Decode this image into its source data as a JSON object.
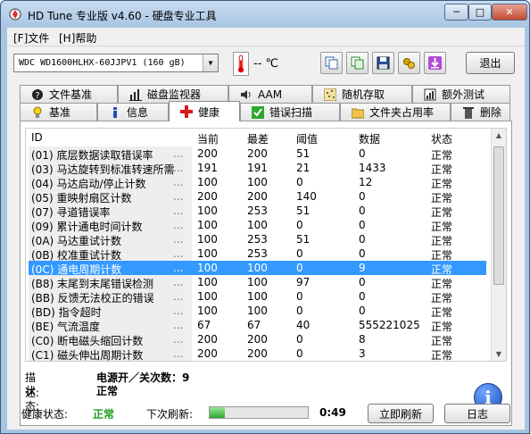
{
  "window": {
    "title": "HD Tune 专业版 v4.60 - 硬盘专业工具",
    "min_label": "─",
    "max_label": "□",
    "close_label": "✕"
  },
  "menu": [
    {
      "label": "[F]文件"
    },
    {
      "label": "[H]帮助"
    }
  ],
  "toolbar": {
    "drive": "WDC WD1600HLHX-60JJPV1 (160 gB)",
    "temperature": "-- ℃",
    "exit_label": "退出",
    "icons": [
      "copy-icon",
      "copy-all-icon",
      "save-icon",
      "options-icon",
      "download-icon"
    ]
  },
  "tabs_top": [
    {
      "label": "文件基准",
      "icon": "file-benchmark-icon"
    },
    {
      "label": "磁盘监视器",
      "icon": "disk-monitor-icon"
    },
    {
      "label": "AAM",
      "icon": "speaker-icon"
    },
    {
      "label": "随机存取",
      "icon": "random-access-icon"
    },
    {
      "label": "额外测试",
      "icon": "extra-tests-icon"
    }
  ],
  "tabs_bottom": [
    {
      "label": "基准",
      "icon": "bulb-icon"
    },
    {
      "label": "信息",
      "icon": "info-small-icon"
    },
    {
      "label": "健康",
      "icon": "health-cross-icon",
      "active": true
    },
    {
      "label": "错误扫描",
      "icon": "error-scan-icon"
    },
    {
      "label": "文件夹占用率",
      "icon": "folder-icon"
    },
    {
      "label": "删除",
      "icon": "trash-icon"
    }
  ],
  "table": {
    "headers": [
      "ID",
      "当前",
      "最差",
      "阈值",
      "数据",
      "状态"
    ],
    "rows": [
      {
        "id": "(01) 底层数据读取错误率",
        "current": "200",
        "worst": "200",
        "threshold": "51",
        "data": "0",
        "status": "正常"
      },
      {
        "id": "(03) 马达旋转到标准转速所需",
        "current": "191",
        "worst": "191",
        "threshold": "21",
        "data": "1433",
        "status": "正常"
      },
      {
        "id": "(04) 马达启动/停止计数",
        "current": "100",
        "worst": "100",
        "threshold": "0",
        "data": "12",
        "status": "正常"
      },
      {
        "id": "(05) 重映射扇区计数",
        "current": "200",
        "worst": "200",
        "threshold": "140",
        "data": "0",
        "status": "正常"
      },
      {
        "id": "(07) 寻道错误率",
        "current": "100",
        "worst": "253",
        "threshold": "51",
        "data": "0",
        "status": "正常"
      },
      {
        "id": "(09) 累计通电时间计数",
        "current": "100",
        "worst": "100",
        "threshold": "0",
        "data": "0",
        "status": "正常"
      },
      {
        "id": "(0A) 马达重试计数",
        "current": "100",
        "worst": "253",
        "threshold": "51",
        "data": "0",
        "status": "正常"
      },
      {
        "id": "(0B) 校准重试计数",
        "current": "100",
        "worst": "253",
        "threshold": "0",
        "data": "0",
        "status": "正常"
      },
      {
        "id": "(0C) 通电周期计数",
        "current": "100",
        "worst": "100",
        "threshold": "0",
        "data": "9",
        "status": "正常",
        "selected": true
      },
      {
        "id": "(B8) 末尾到末尾错误检测",
        "current": "100",
        "worst": "100",
        "threshold": "97",
        "data": "0",
        "status": "正常"
      },
      {
        "id": "(BB) 反馈无法校正的错误",
        "current": "100",
        "worst": "100",
        "threshold": "0",
        "data": "0",
        "status": "正常"
      },
      {
        "id": "(BD) 指令超时",
        "current": "100",
        "worst": "100",
        "threshold": "0",
        "data": "0",
        "status": "正常"
      },
      {
        "id": "(BE) 气流温度",
        "current": "67",
        "worst": "67",
        "threshold": "40",
        "data": "555221025",
        "status": "正常"
      },
      {
        "id": "(C0) 断电磁头缩回计数",
        "current": "200",
        "worst": "200",
        "threshold": "0",
        "data": "8",
        "status": "正常"
      },
      {
        "id": "(C1) 磁头伸出周期计数",
        "current": "200",
        "worst": "200",
        "threshold": "0",
        "data": "3",
        "status": "正常"
      }
    ]
  },
  "detail": {
    "desc_label": "描述:",
    "desc_value": "电源开／关次数：9",
    "status_label": "状态:",
    "status_value": "正常"
  },
  "statusbar": {
    "health_label": "健康状态:",
    "health_value": "正常",
    "refresh_label": "下次刷新:",
    "refresh_progress": 0.15,
    "refresh_time": "0:49",
    "refresh_now_label": "立即刷新",
    "log_label": "日志"
  }
}
